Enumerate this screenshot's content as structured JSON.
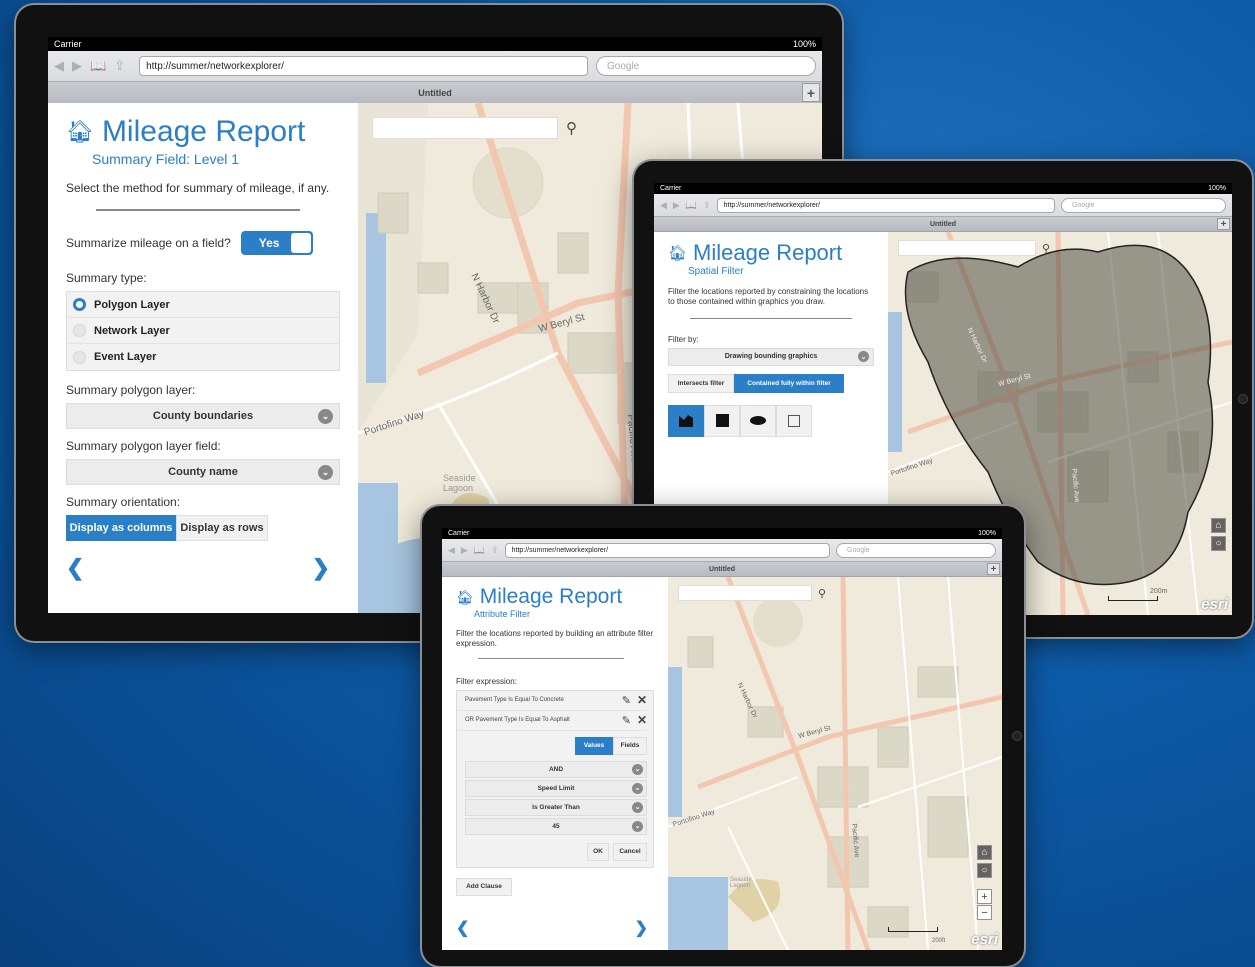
{
  "colors": {
    "accent": "#2a7fc7",
    "background": "#0d5aa6",
    "map_land": "#efeadb"
  },
  "common": {
    "carrier": "Carrier",
    "battery": "100%",
    "url": "http://summer/networkexplorer/",
    "search_placeholder": "Google",
    "tab_title": "Untitled",
    "new_tab": "+",
    "app_title": "Mileage Report",
    "prev": "❮",
    "next": "❯",
    "search_icon": "search-icon",
    "home_icon": "home-icon"
  },
  "t1": {
    "subtitle": "Summary Field: Level 1",
    "instruction": "Select the method for summary of mileage, if any.",
    "summarize_label": "Summarize mileage on a field?",
    "summarize_value": "Yes",
    "summary_type_label": "Summary type:",
    "summary_types": [
      "Polygon Layer",
      "Network Layer",
      "Event Layer"
    ],
    "polygon_layer_label": "Summary polygon layer:",
    "polygon_layer_value": "County boundaries",
    "polygon_field_label": "Summary polygon layer field:",
    "polygon_field_value": "County name",
    "orientation_label": "Summary orientation:",
    "orientation_columns": "Display as columns",
    "orientation_rows": "Display as rows",
    "map_labels": {
      "beryl": "W Beryl St",
      "harbor": "N Harbor Dr",
      "portofino": "Portofino Way",
      "lagoon": "Seaside\nLagoon",
      "pacific": "Pacific Ave"
    }
  },
  "t2": {
    "subtitle": "Spatial Filter",
    "instruction": "Filter the locations reported by constraining the locations to those contained within graphics you draw.",
    "filter_by_label": "Filter by:",
    "filter_by_value": "Drawing bounding graphics",
    "intersects": "Intersects filter",
    "contained": "Contained fully within filter",
    "tools": [
      "freehand-polygon-tool",
      "rectangle-tool",
      "ellipse-tool",
      "extent-tool"
    ],
    "scale": "200m",
    "esri": "esri",
    "map_labels": {
      "beryl": "W Beryl St",
      "harbor": "N Harbor Dr",
      "portofino": "Portofino Way",
      "pacific": "Pacific Ave"
    }
  },
  "t3": {
    "subtitle": "Attribute Filter",
    "instruction": "Filter the locations reported by building an attribute filter expression.",
    "expression_label": "Filter expression:",
    "clauses": [
      "Pavement Type Is Equal To Concrete",
      "OR Pavement Type Is Equal To Asphalt"
    ],
    "values_tab": "Values",
    "fields_tab": "Fields",
    "selects": [
      "AND",
      "Speed Limit",
      "Is Greater Than",
      "45"
    ],
    "ok": "OK",
    "cancel": "Cancel",
    "add_clause": "Add Clause",
    "scale": "200ft",
    "zoom_in": "+",
    "zoom_out": "−",
    "esri": "esri",
    "map_labels": {
      "beryl": "W Beryl St",
      "harbor": "N Harbor Dr",
      "portofino": "Portofino Way",
      "lagoon": "Seaside\nLagoon",
      "pacific": "Pacific Ave"
    }
  }
}
